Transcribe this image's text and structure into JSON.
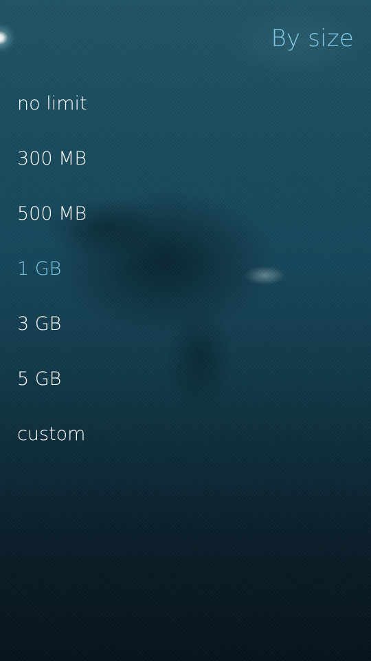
{
  "header": {
    "title": "By size"
  },
  "options": [
    {
      "label": "no limit",
      "selected": false
    },
    {
      "label": "300 MB",
      "selected": false
    },
    {
      "label": "500 MB",
      "selected": false
    },
    {
      "label": "1 GB",
      "selected": true
    },
    {
      "label": "3 GB",
      "selected": false
    },
    {
      "label": "5 GB",
      "selected": false
    },
    {
      "label": "custom",
      "selected": false
    }
  ],
  "colors": {
    "highlight": "#7fc6e6",
    "primary_text": "#ffffff",
    "background_top": "#1f5565",
    "background_bottom": "#07141c"
  }
}
